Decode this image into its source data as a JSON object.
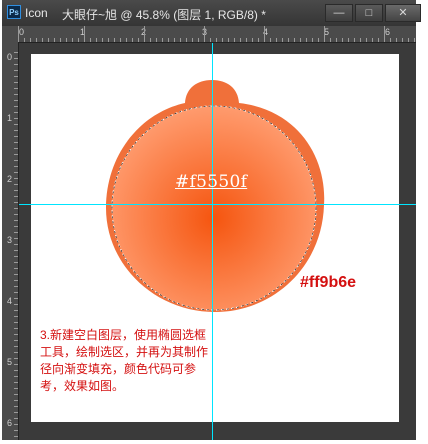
{
  "window": {
    "app_icon": "ps-icon",
    "app_icon_text": "Ps",
    "doc_name": "Icon",
    "title": "大眼仔~旭 @ 45.8% (图层 1, RGB/8) *",
    "buttons": {
      "minimize": "—",
      "maximize": "□",
      "close": "✕"
    }
  },
  "rulers": {
    "top": [
      "0",
      "1",
      "2",
      "3",
      "4",
      "5",
      "6"
    ],
    "left": [
      "0",
      "1",
      "2",
      "3",
      "4",
      "5",
      "6"
    ]
  },
  "canvas": {
    "background": "#ffffff",
    "guide_color": "#00e5ff",
    "shape_colors": {
      "center": "#f5550f",
      "outer": "#ff9b6e"
    },
    "label_center_color": "#f5550f",
    "label_outer_color": "#ff9b6e",
    "instruction": "3.新建空白图层，使用椭圆选框工具，绘制选区，并再为其制作径向渐变填充，颜色代码可参考，效果如图。"
  }
}
